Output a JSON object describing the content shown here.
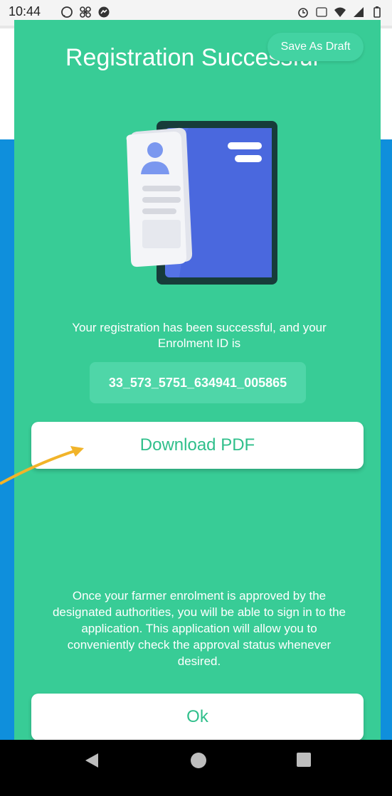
{
  "status_bar": {
    "time": "10:44"
  },
  "header": {
    "title": "Registration Successful",
    "draft_label": "Save As Draft"
  },
  "main": {
    "message": "Your registration has been successful, and your Enrolment ID is",
    "enrolment_id": "33_573_5751_634941_005865",
    "download_label": "Download PDF",
    "note": "Once your farmer enrolment is approved by the designated authorities, you will be able to sign in to the application. This application will allow you to conveniently check the approval status whenever desired.",
    "ok_label": "Ok"
  },
  "colors": {
    "panel": "#38cc96",
    "background": "#0f8fdc",
    "accent_text": "#2fbf8b",
    "arrow": "#f1b42a"
  }
}
